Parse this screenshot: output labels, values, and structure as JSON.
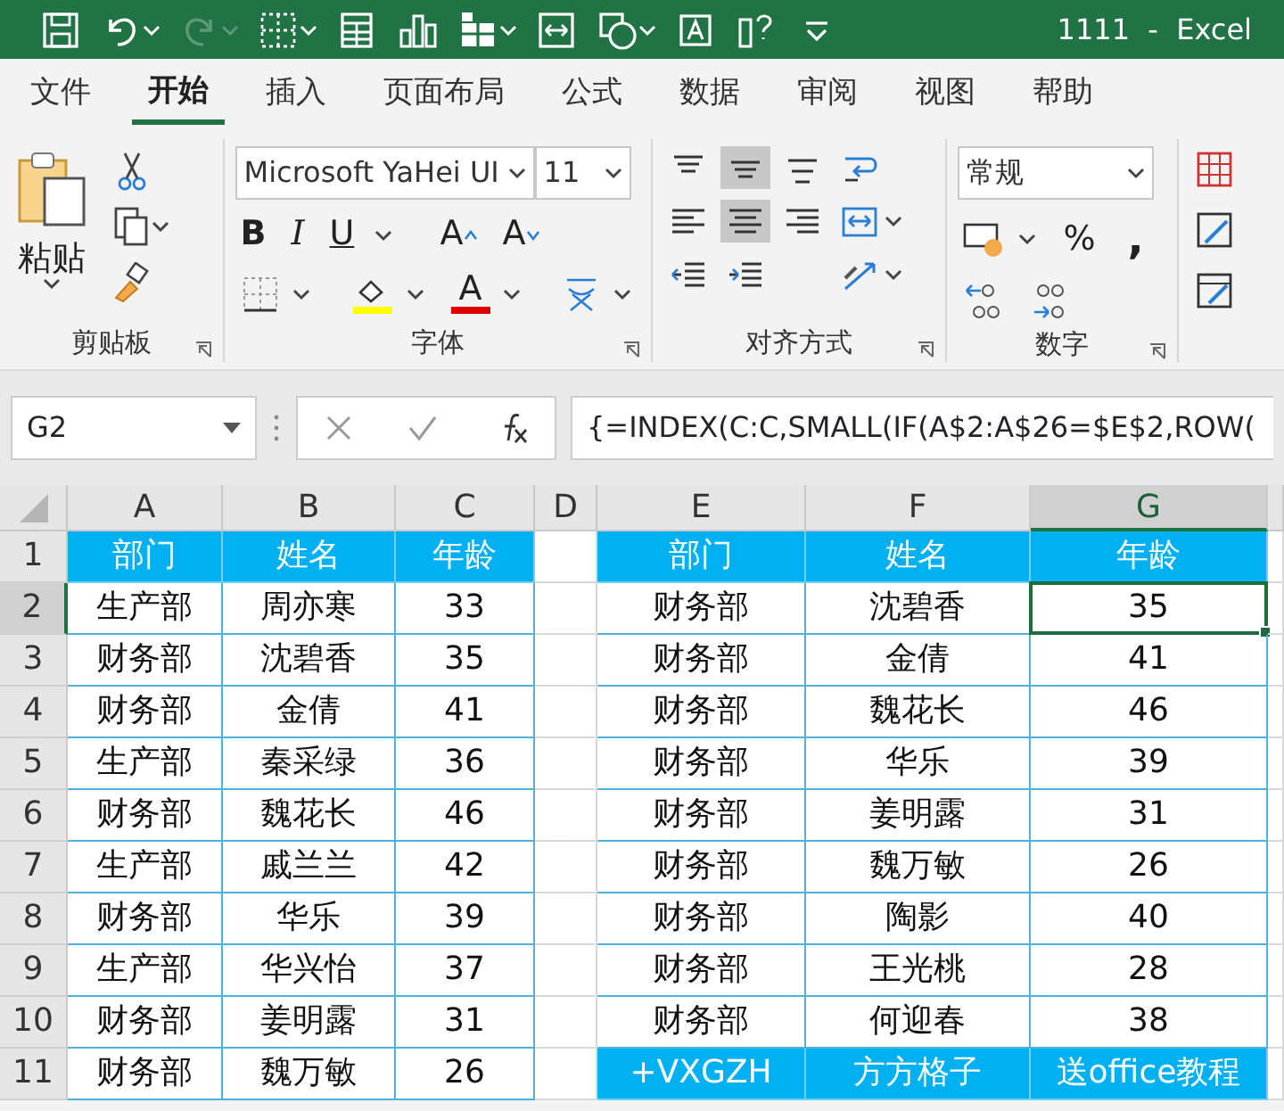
{
  "title_bar": {
    "quick_access": [
      {
        "kind": "save",
        "menu": false,
        "disabled": false
      },
      {
        "kind": "undo",
        "menu": true,
        "disabled": false
      },
      {
        "kind": "redo",
        "menu": true,
        "disabled": true
      },
      {
        "kind": "borders",
        "menu": true,
        "disabled": false
      },
      {
        "kind": "form",
        "menu": false,
        "disabled": false
      },
      {
        "kind": "chart",
        "menu": false,
        "disabled": false
      },
      {
        "kind": "pivot",
        "menu": true,
        "disabled": false
      },
      {
        "kind": "camera",
        "menu": false,
        "disabled": false
      },
      {
        "kind": "shapes",
        "menu": true,
        "disabled": false
      },
      {
        "kind": "textbox",
        "menu": false,
        "disabled": false
      },
      {
        "kind": "whatif",
        "menu": false,
        "disabled": false
      },
      {
        "kind": "customize",
        "menu": false,
        "disabled": false
      }
    ],
    "title": "1111  -  Excel"
  },
  "tabs": [
    {
      "label": "文件",
      "selected": false
    },
    {
      "label": "开始",
      "selected": true
    },
    {
      "label": "插入",
      "selected": false
    },
    {
      "label": "页面布局",
      "selected": false
    },
    {
      "label": "公式",
      "selected": false
    },
    {
      "label": "数据",
      "selected": false
    },
    {
      "label": "审阅",
      "selected": false
    },
    {
      "label": "视图",
      "selected": false
    },
    {
      "label": "帮助",
      "selected": false
    }
  ],
  "ribbon": {
    "groups": [
      {
        "kind": "clipboard",
        "label": "剪贴板",
        "paste_label": "粘贴"
      },
      {
        "kind": "font",
        "label": "字体",
        "font_name": "Microsoft YaHei UI",
        "font_size": "11",
        "bold": "B",
        "italic": "I",
        "underline": "U",
        "grow": "A",
        "shrink": "A",
        "font_color": "A"
      },
      {
        "kind": "alignment",
        "label": "对齐方式",
        "buttons": [
          {
            "kind": "align-top",
            "selected": false
          },
          {
            "kind": "align-middle",
            "selected": true
          },
          {
            "kind": "align-bottom",
            "selected": false
          },
          {
            "kind": "wrap",
            "selected": false
          },
          {
            "kind": "align-left",
            "selected": false
          },
          {
            "kind": "align-center",
            "selected": true
          },
          {
            "kind": "align-right",
            "selected": false
          },
          {
            "kind": "merge",
            "selected": false
          },
          {
            "kind": "outdent",
            "selected": false
          },
          {
            "kind": "indent",
            "selected": false
          },
          {
            "kind": "orientation",
            "selected": false
          }
        ]
      },
      {
        "kind": "number",
        "label": "数字",
        "format": "常规",
        "percent": "%",
        "comma": ","
      },
      {
        "kind": "cells"
      }
    ]
  },
  "formula_bar": {
    "name_box": "G2",
    "formula": "{=INDEX(C:C,SMALL(IF(A$2:A$26=$E$2,ROW("
  },
  "sheet": {
    "columns": [
      {
        "label": "A",
        "selected": false
      },
      {
        "label": "B",
        "selected": false
      },
      {
        "label": "C",
        "selected": false
      },
      {
        "label": "D",
        "selected": false
      },
      {
        "label": "E",
        "selected": false
      },
      {
        "label": "F",
        "selected": false
      },
      {
        "label": "G",
        "selected": true
      }
    ],
    "rows": [
      {
        "label": "1",
        "selected": false,
        "groups": [
          {
            "kind": "header",
            "cells": [
              "部门",
              "姓名",
              "年龄"
            ]
          },
          {
            "kind": "header",
            "cells": [
              "部门",
              "姓名",
              "年龄"
            ]
          }
        ]
      },
      {
        "label": "2",
        "selected": true,
        "groups": [
          {
            "kind": "data",
            "cells": [
              "生产部",
              "周亦寒",
              "33"
            ]
          },
          {
            "kind": "data",
            "cells": [
              "财务部",
              "沈碧香",
              "35"
            ]
          }
        ]
      },
      {
        "label": "3",
        "selected": false,
        "groups": [
          {
            "kind": "data",
            "cells": [
              "财务部",
              "沈碧香",
              "35"
            ]
          },
          {
            "kind": "data",
            "cells": [
              "财务部",
              "金倩",
              "41"
            ]
          }
        ]
      },
      {
        "label": "4",
        "selected": false,
        "groups": [
          {
            "kind": "data",
            "cells": [
              "财务部",
              "金倩",
              "41"
            ]
          },
          {
            "kind": "data",
            "cells": [
              "财务部",
              "魏花长",
              "46"
            ]
          }
        ]
      },
      {
        "label": "5",
        "selected": false,
        "groups": [
          {
            "kind": "data",
            "cells": [
              "生产部",
              "秦采绿",
              "36"
            ]
          },
          {
            "kind": "data",
            "cells": [
              "财务部",
              "华乐",
              "39"
            ]
          }
        ]
      },
      {
        "label": "6",
        "selected": false,
        "groups": [
          {
            "kind": "data",
            "cells": [
              "财务部",
              "魏花长",
              "46"
            ]
          },
          {
            "kind": "data",
            "cells": [
              "财务部",
              "姜明露",
              "31"
            ]
          }
        ]
      },
      {
        "label": "7",
        "selected": false,
        "groups": [
          {
            "kind": "data",
            "cells": [
              "生产部",
              "戚兰兰",
              "42"
            ]
          },
          {
            "kind": "data",
            "cells": [
              "财务部",
              "魏万敏",
              "26"
            ]
          }
        ]
      },
      {
        "label": "8",
        "selected": false,
        "groups": [
          {
            "kind": "data",
            "cells": [
              "财务部",
              "华乐",
              "39"
            ]
          },
          {
            "kind": "data",
            "cells": [
              "财务部",
              "陶影",
              "40"
            ]
          }
        ]
      },
      {
        "label": "9",
        "selected": false,
        "groups": [
          {
            "kind": "data",
            "cells": [
              "生产部",
              "华兴怡",
              "37"
            ]
          },
          {
            "kind": "data",
            "cells": [
              "财务部",
              "王光桃",
              "28"
            ]
          }
        ]
      },
      {
        "label": "10",
        "selected": false,
        "groups": [
          {
            "kind": "data",
            "cells": [
              "财务部",
              "姜明露",
              "31"
            ]
          },
          {
            "kind": "data",
            "cells": [
              "财务部",
              "何迎春",
              "38"
            ]
          }
        ]
      },
      {
        "label": "11",
        "selected": false,
        "groups": [
          {
            "kind": "data",
            "cells": [
              "财务部",
              "魏万敏",
              "26"
            ]
          },
          {
            "kind": "header",
            "cells": [
              "+VXGZH",
              "方方格子",
              "送office教程"
            ]
          }
        ]
      }
    ]
  }
}
